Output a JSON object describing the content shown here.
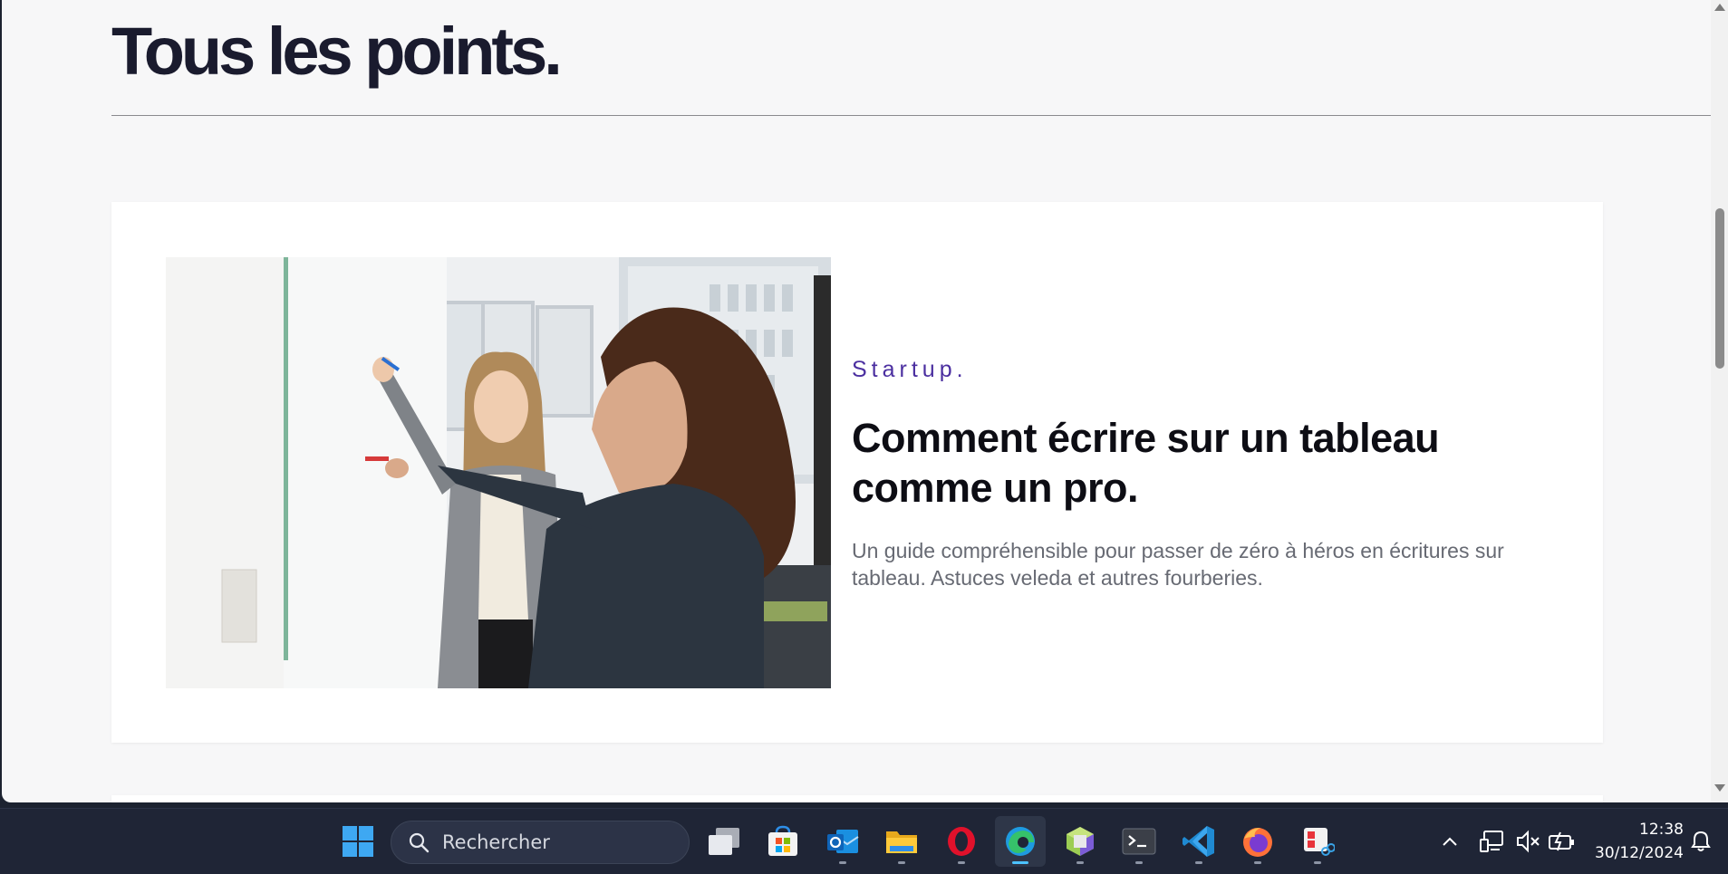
{
  "page": {
    "title": "Tous les points."
  },
  "article": {
    "category": "Startup.",
    "headline": "Comment écrire sur un tableau comme un pro.",
    "excerpt": "Un guide compréhensible pour passer de zéro à héros en écritures sur tableau. Astuces veleda et autres fourberies.",
    "image_alt": "Deux femmes écrivant sur un tableau blanc dans un bureau"
  },
  "colors": {
    "page_bg": "#f7f7f8",
    "card_bg": "#ffffff",
    "title": "#1a1b2e",
    "category": "#4b2fa0",
    "headline": "#0d0d14",
    "excerpt": "#676a73",
    "taskbar_bg": "#1f2536",
    "accent": "#4cc2ff"
  },
  "taskbar": {
    "search_placeholder": "Rechercher",
    "apps": [
      {
        "icon": "windows-start-icon"
      },
      {
        "icon": "task-view-icon"
      },
      {
        "icon": "microsoft-store-icon"
      },
      {
        "icon": "outlook-icon"
      },
      {
        "icon": "file-explorer-icon"
      },
      {
        "icon": "opera-icon"
      },
      {
        "icon": "edge-icon",
        "active": true
      },
      {
        "icon": "phpstorm-icon"
      },
      {
        "icon": "terminal-icon"
      },
      {
        "icon": "vscode-icon"
      },
      {
        "icon": "firefox-icon"
      },
      {
        "icon": "snipping-tool-icon"
      }
    ],
    "tray": {
      "time": "12:38",
      "date": "30/12/2024"
    }
  }
}
